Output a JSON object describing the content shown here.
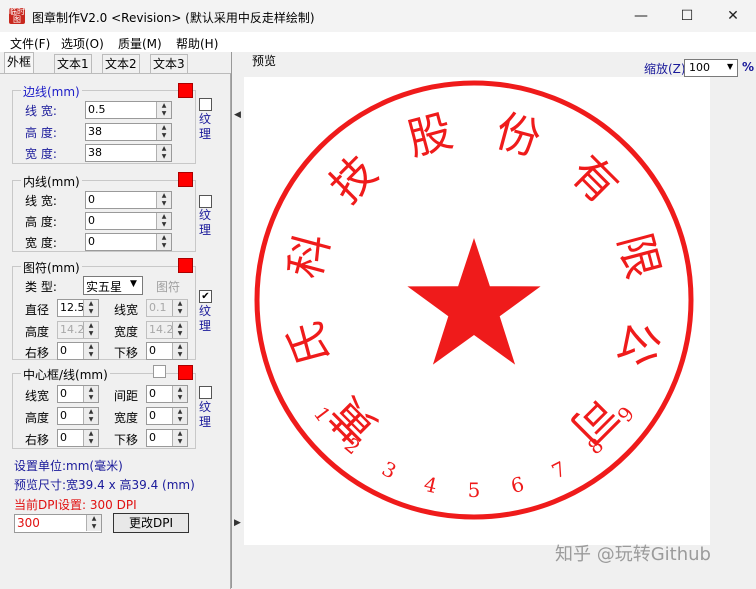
{
  "window": {
    "title": "图章制作V2.0 <Revision> (默认采用中反走样绘制)",
    "app_icon_text": "临时图",
    "btn_minimize": "—",
    "btn_maximize": "☐",
    "btn_close": "✕"
  },
  "menu": [
    "文件(F)",
    "选项(O)",
    "质量(M)",
    "帮助(H)"
  ],
  "tabs": [
    "外框",
    "文本1",
    "文本2",
    "文本3"
  ],
  "border": {
    "legend": "边线(mm)",
    "rows": [
      {
        "label": "线  宽:",
        "value": "0.5"
      },
      {
        "label": "高  度:",
        "value": "38"
      },
      {
        "label": "宽  度:",
        "value": "38"
      }
    ],
    "color": "#ff0000",
    "texture_label": "纹理",
    "texture_checked": false
  },
  "inner": {
    "legend": "内线(mm)",
    "rows": [
      {
        "label": "线  宽:",
        "value": "0"
      },
      {
        "label": "高  度:",
        "value": "0"
      },
      {
        "label": "宽  度:",
        "value": "0"
      }
    ],
    "color": "#ff0000",
    "texture_label": "纹理",
    "texture_checked": false
  },
  "symbol": {
    "legend": "图符(mm)",
    "type_label": "类  型:",
    "type_value": "实五星",
    "symbol_btn": "图符",
    "diameter_label": "直径",
    "diameter_value": "12.5",
    "linewidth_label": "线宽",
    "linewidth_value": "0.1",
    "height_label": "高度",
    "height_value": "14.2",
    "width_label": "宽度",
    "width_value": "14.2",
    "right_label": "右移",
    "right_value": "0",
    "down_label": "下移",
    "down_value": "0",
    "color": "#ff0000",
    "texture_label": "纹理",
    "texture_checked": true,
    "check_mark": "✔"
  },
  "center": {
    "legend": "中心框/线(mm)",
    "lw_label": "线宽",
    "lw_value": "0",
    "gap_label": "间距",
    "gap_value": "0",
    "h_label": "高度",
    "h_value": "0",
    "w_label": "宽度",
    "w_value": "0",
    "right_label": "右移",
    "right_value": "0",
    "down_label": "下移",
    "down_value": "0",
    "color": "#ff0000",
    "texture_label": "纹理",
    "texture_checked": false
  },
  "units_text": "设置单位:mm(毫米)",
  "preview_size_text": "预览尺寸:宽39.4 x 高39.4 (mm)",
  "dpi_text": "当前DPI设置: 300 DPI",
  "dpi_value": "300",
  "dpi_button": "更改DPI",
  "preview": {
    "label": "预览",
    "zoom_label": "缩放(Z)",
    "zoom_value": "100",
    "zoom_unit": "%"
  },
  "seal": {
    "color": "#ef1b1b",
    "text_main": [
      "黄",
      "氏",
      "科",
      "技",
      "股",
      "份",
      "有",
      "限",
      "公",
      "司"
    ],
    "text_numbers": [
      "1",
      "2",
      "3",
      "4",
      "5",
      "6",
      "7",
      "8",
      "9"
    ]
  },
  "watermark": "知乎 @玩转Github"
}
